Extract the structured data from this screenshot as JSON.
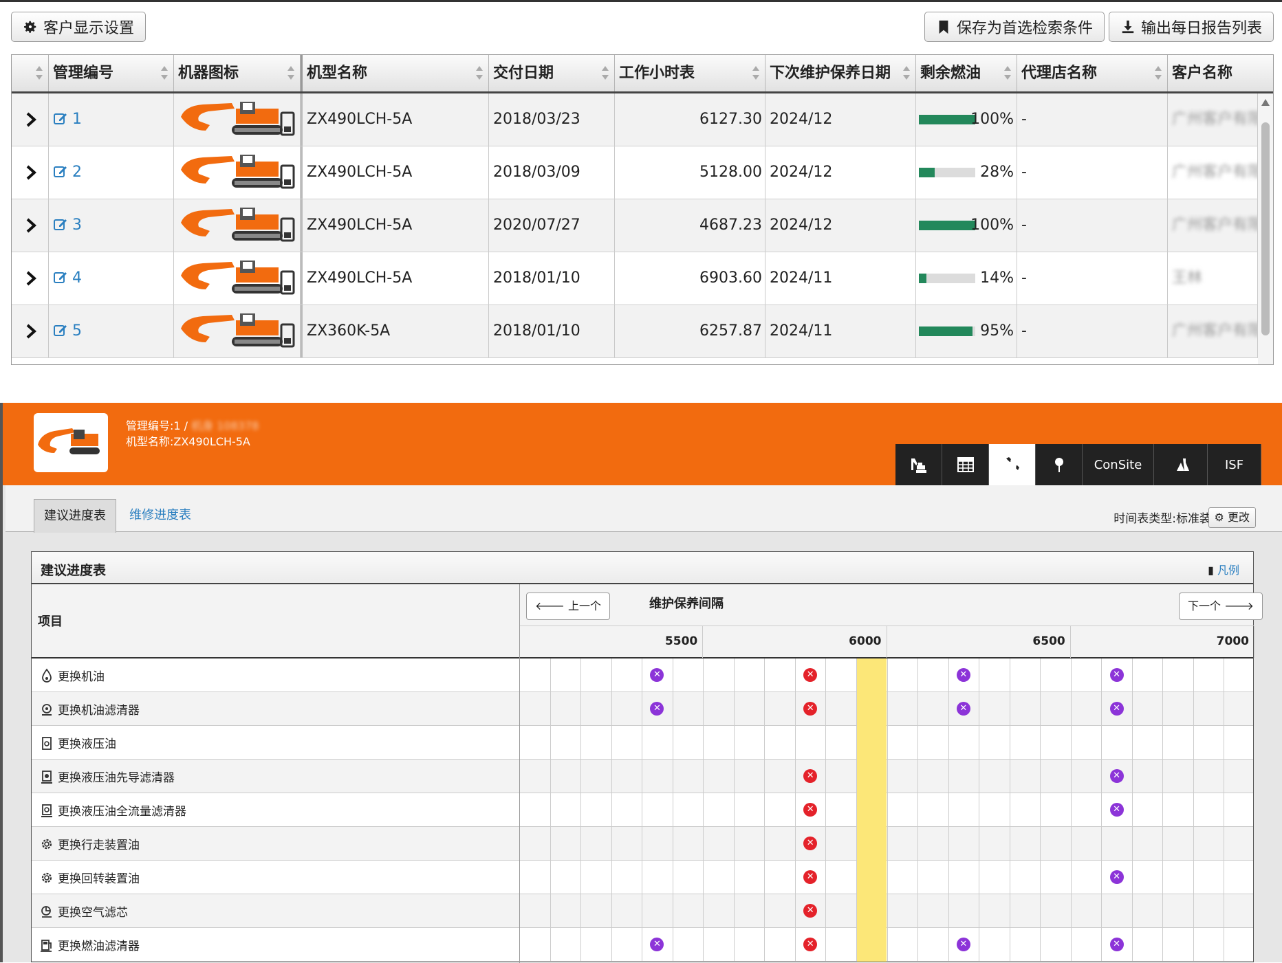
{
  "toolbar": {
    "customer_display_settings": "客户显示设置",
    "save_search": "保存为首选检索条件",
    "export_daily_report": "输出每日报告列表"
  },
  "table": {
    "headers": [
      "管理编号",
      "机器图标",
      "机型名称",
      "交付日期",
      "工作小时表",
      "下次维护保养日期",
      "剩余燃油",
      "代理店名称",
      "客户名称"
    ],
    "rows": [
      {
        "id": "1",
        "model": "ZX490LCH-5A",
        "delivery": "2018/03/23",
        "hours": "6127.30",
        "next_maint": "2024/12",
        "fuel_pct": 100,
        "fuel": "100%",
        "dealer": "-",
        "customer": "广州客户有限公司"
      },
      {
        "id": "2",
        "model": "ZX490LCH-5A",
        "delivery": "2018/03/09",
        "hours": "5128.00",
        "next_maint": "2024/12",
        "fuel_pct": 28,
        "fuel": "28%",
        "dealer": "-",
        "customer": "广州客户有限公司"
      },
      {
        "id": "3",
        "model": "ZX490LCH-5A",
        "delivery": "2020/07/27",
        "hours": "4687.23",
        "next_maint": "2024/12",
        "fuel_pct": 100,
        "fuel": "100%",
        "dealer": "-",
        "customer": "广州客户有限公司"
      },
      {
        "id": "4",
        "model": "ZX490LCH-5A",
        "delivery": "2018/01/10",
        "hours": "6903.60",
        "next_maint": "2024/11",
        "fuel_pct": 14,
        "fuel": "14%",
        "dealer": "-",
        "customer": "王林"
      },
      {
        "id": "5",
        "model": "ZX360K-5A",
        "delivery": "2018/01/10",
        "hours": "6257.87",
        "next_maint": "2024/11",
        "fuel_pct": 95,
        "fuel": "95%",
        "dealer": "-",
        "customer": "广州客户有限公司"
      }
    ]
  },
  "detail": {
    "mgmt_no": "管理编号:1 / ",
    "mgmt_blur": "机身 108378",
    "model_name": "机型名称:ZX490LCH-5A",
    "tabs": [
      "machine-icon",
      "table-icon",
      "wrench-icon",
      "pin-icon",
      "ConSite",
      "flask-icon",
      "ISF"
    ],
    "active_tab": 2,
    "subtabs": {
      "recommended": "建议进度表",
      "repair": "维修进度表"
    },
    "schedule_type": "时间表类型:标准装置",
    "change": "更改"
  },
  "schedule": {
    "title": "建议进度表",
    "legend": "凡例",
    "item_col": "项目",
    "interval_title": "维护保养间隔",
    "prev": "上一个",
    "next": "下一个",
    "hour_labels": [
      "5500",
      "6000",
      "6500",
      "7000"
    ],
    "items": [
      {
        "label": "更换机油",
        "icon": "oil-drop-icon",
        "marks": [
          [
            4,
            "purple"
          ],
          [
            9,
            "red"
          ],
          [
            14,
            "purple"
          ],
          [
            19,
            "purple"
          ]
        ]
      },
      {
        "label": "更换机油滤清器",
        "icon": "oil-filter-icon",
        "marks": [
          [
            4,
            "purple"
          ],
          [
            9,
            "red"
          ],
          [
            14,
            "purple"
          ],
          [
            19,
            "purple"
          ]
        ]
      },
      {
        "label": "更换液压油",
        "icon": "hydraulic-oil-icon",
        "marks": []
      },
      {
        "label": "更换液压油先导滤清器",
        "icon": "pilot-filter-icon",
        "marks": [
          [
            9,
            "red"
          ],
          [
            19,
            "purple"
          ]
        ]
      },
      {
        "label": "更换液压油全流量滤清器",
        "icon": "full-flow-filter-icon",
        "marks": [
          [
            9,
            "red"
          ],
          [
            19,
            "purple"
          ]
        ]
      },
      {
        "label": "更换行走装置油",
        "icon": "gear-icon",
        "marks": [
          [
            9,
            "red"
          ]
        ]
      },
      {
        "label": "更换回转装置油",
        "icon": "gear-icon",
        "marks": [
          [
            9,
            "red"
          ],
          [
            19,
            "purple"
          ]
        ]
      },
      {
        "label": "更换空气滤芯",
        "icon": "air-filter-icon",
        "marks": [
          [
            9,
            "red"
          ]
        ]
      },
      {
        "label": "更换燃油滤清器",
        "icon": "fuel-filter-icon",
        "marks": [
          [
            4,
            "purple"
          ],
          [
            9,
            "red"
          ],
          [
            14,
            "purple"
          ],
          [
            19,
            "purple"
          ]
        ]
      }
    ],
    "highlight_col": 11,
    "colors": {
      "purple": "#8c34d8",
      "red": "#e4222a",
      "highlight": "#fce778",
      "header_orange": "#f26b0f",
      "fuel_green": "#23885b"
    }
  }
}
